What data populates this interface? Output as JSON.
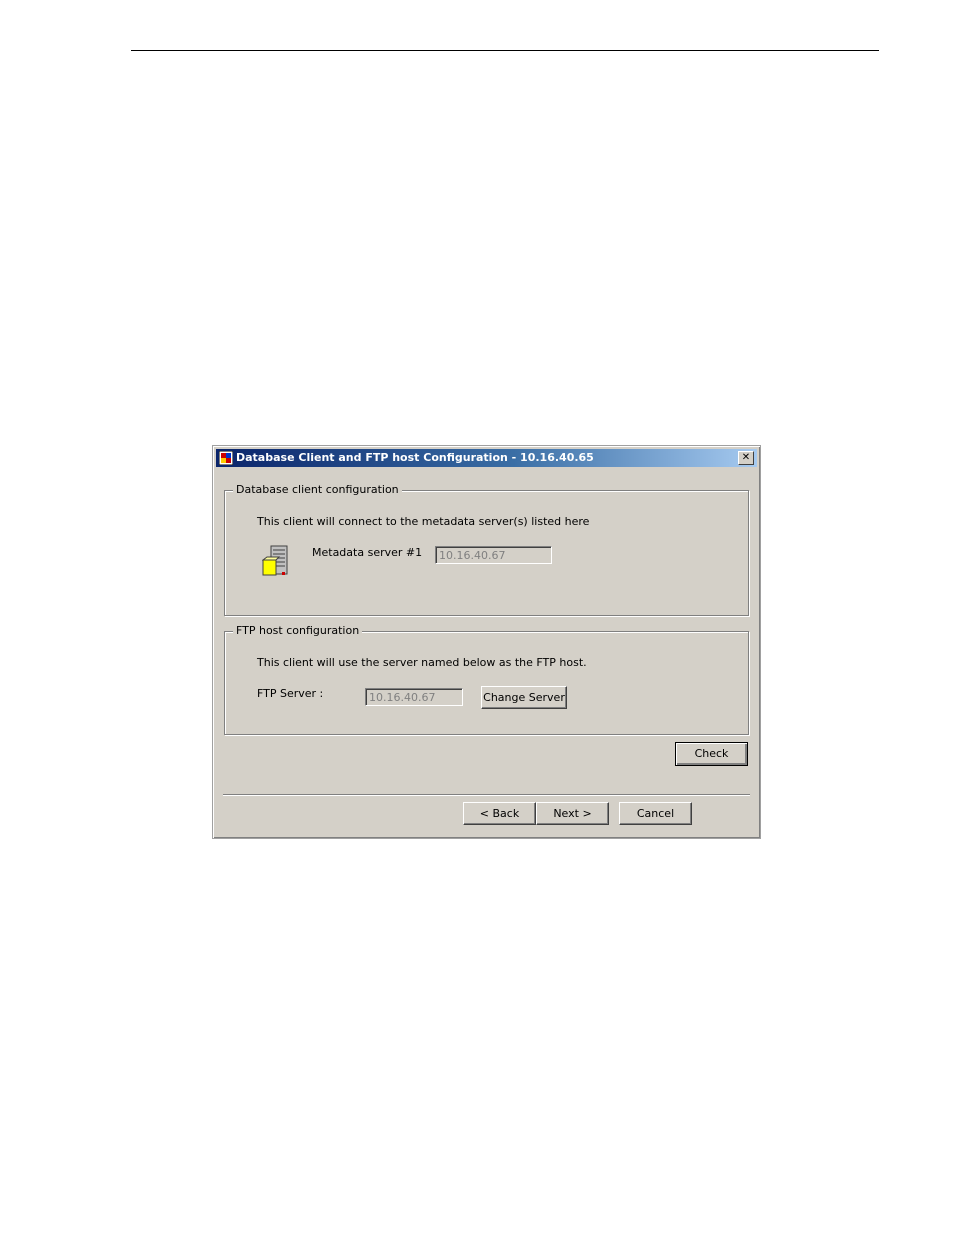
{
  "dialog": {
    "title": "Database Client and FTP host Configuration - 10.16.40.65",
    "close_label": "✕"
  },
  "database_group": {
    "legend": "Database client configuration",
    "description": "This client will connect to the metadata server(s) listed here",
    "server_label": "Metadata server #1",
    "server_value": "10.16.40.67",
    "server_icon": "server-icon"
  },
  "ftp_group": {
    "legend": "FTP host configuration",
    "description": "This client will use the server named below as the FTP host.",
    "server_label": "FTP Server :",
    "server_value": "10.16.40.67",
    "change_label": "Change Server"
  },
  "buttons": {
    "check": "Check",
    "back": "< Back",
    "next": "Next >",
    "cancel": "Cancel"
  }
}
